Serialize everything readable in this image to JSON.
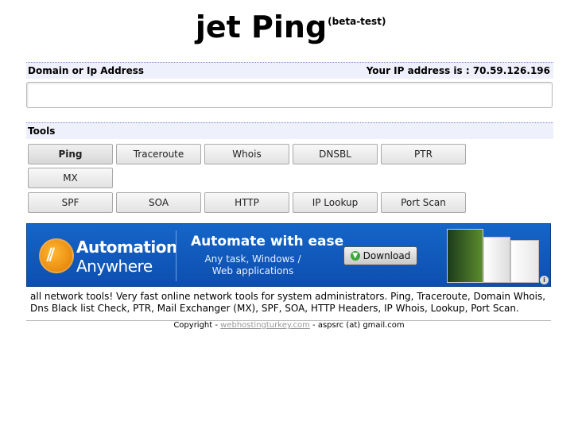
{
  "header": {
    "title": "jet Ping",
    "badge": "(beta-test)"
  },
  "domain_section": {
    "label": "Domain or Ip Address",
    "your_ip_label": "Your IP address is : 70.59.126.196"
  },
  "search": {
    "value": "",
    "placeholder": ""
  },
  "tools_section": {
    "label": "Tools"
  },
  "tools": {
    "row1": [
      "Ping",
      "Traceroute",
      "Whois",
      "DNSBL",
      "PTR"
    ],
    "row2": [
      "MX"
    ],
    "row3": [
      "SPF",
      "SOA",
      "HTTP",
      "IP Lookup",
      "Port Scan"
    ],
    "active": "Ping"
  },
  "ad": {
    "brand_line1": "Automation",
    "brand_line2": "Anywhere",
    "headline": "Automate with ease",
    "subtext": "Any task, Windows / Web applications",
    "cta": "Download",
    "info_icon": "info-icon",
    "colors": {
      "background": "#1565c8",
      "logo": "#e07a00"
    }
  },
  "description": "all network tools! Very fast online network tools for system administrators. Ping, Traceroute, Domain Whois, Dns Black list Check, PTR, Mail Exchanger (MX), SPF, SOA, HTTP Headers, IP Whois, Lookup, Port Scan.",
  "footer": {
    "prefix": "Copyright - ",
    "link_text": "webhostingturkey.com",
    "suffix": " - aspsrc (at) gmail.com"
  }
}
